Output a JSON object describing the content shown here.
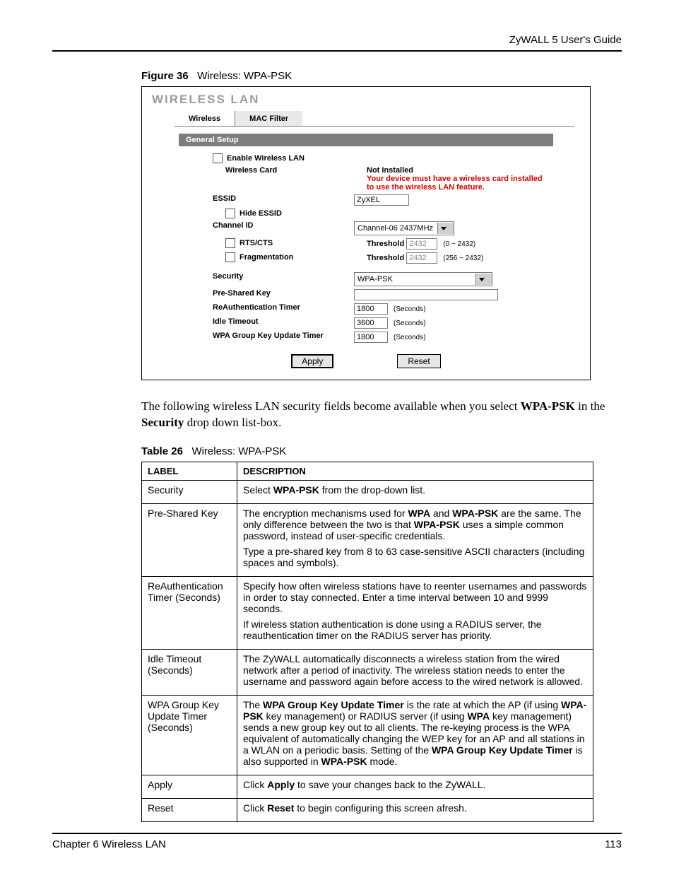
{
  "doc": {
    "running_head": "ZyWALL 5 User's Guide",
    "figure_number": "Figure 36",
    "figure_title": "Wireless: WPA-PSK",
    "table_number": "Table 26",
    "table_title": "Wireless: WPA-PSK",
    "body_para": "The following wireless LAN security fields become available when you select ",
    "body_bold1": "WPA-PSK",
    "body_mid": " in the ",
    "body_bold2": "Security",
    "body_end": " drop down list-box.",
    "footer_left": "Chapter 6 Wireless LAN",
    "footer_right": "113"
  },
  "shot": {
    "title": "WIRELESS LAN",
    "tabs": {
      "wireless": "Wireless",
      "mac": "MAC Filter"
    },
    "section": "General Setup",
    "labels": {
      "enable": "Enable Wireless LAN",
      "card": "Wireless Card",
      "not_installed": "Not Installed",
      "warn": "Your device must have a wireless card installed to use the wireless LAN feature.",
      "essid": "ESSID",
      "hide": "Hide ESSID",
      "channel": "Channel ID",
      "rtscts": "RTS/CTS",
      "frag": "Fragmentation",
      "security": "Security",
      "psk": "Pre-Shared Key",
      "reauth": "ReAuthentication Timer",
      "idle": "Idle Timeout",
      "group": "WPA Group Key Update Timer",
      "threshold": "Threshold",
      "seconds": "(Seconds)",
      "rts_range": "(0 ~ 2432)",
      "frag_range": "(256 ~ 2432)"
    },
    "values": {
      "essid": "ZyXEL",
      "channel": "Channel-06 2437MHz",
      "rts": "2432",
      "frag": "2432",
      "security": "WPA-PSK",
      "psk": "",
      "reauth": "1800",
      "idle": "3600",
      "group": "1800"
    },
    "buttons": {
      "apply": "Apply",
      "reset": "Reset"
    }
  },
  "table": {
    "head_label": "LABEL",
    "head_desc": "DESCRIPTION",
    "rows": [
      {
        "label": "Security",
        "desc": [
          {
            "runs": [
              {
                "t": "Select "
              },
              {
                "b": "WPA-PSK"
              },
              {
                "t": " from the drop-down list."
              }
            ]
          }
        ]
      },
      {
        "label": "Pre-Shared Key",
        "desc": [
          {
            "runs": [
              {
                "t": "The encryption mechanisms used for "
              },
              {
                "b": "WPA"
              },
              {
                "t": " and "
              },
              {
                "b": "WPA-PSK"
              },
              {
                "t": " are the same. The only difference between the two is that "
              },
              {
                "b": "WPA-PSK"
              },
              {
                "t": " uses a simple common password, instead of user-specific credentials."
              }
            ]
          },
          {
            "runs": [
              {
                "t": "Type a pre-shared key from 8 to 63 case-sensitive ASCII characters (including spaces and symbols)."
              }
            ]
          }
        ]
      },
      {
        "label": "ReAuthentication Timer (Seconds)",
        "desc": [
          {
            "runs": [
              {
                "t": "Specify how often wireless stations have to reenter usernames and passwords in order to stay connected. Enter a time interval between 10 and 9999 seconds."
              }
            ]
          },
          {
            "runs": [
              {
                "t": "If wireless station authentication is done using a RADIUS server, the reauthentication timer on the RADIUS server has priority."
              }
            ]
          }
        ]
      },
      {
        "label": "Idle Timeout (Seconds)",
        "desc": [
          {
            "runs": [
              {
                "t": "The ZyWALL automatically disconnects a wireless station from the wired network after a period of inactivity. The wireless station needs to enter the username and password again before access to the wired network is allowed."
              }
            ]
          }
        ]
      },
      {
        "label": "WPA Group Key Update Timer (Seconds)",
        "desc": [
          {
            "runs": [
              {
                "t": "The "
              },
              {
                "b": "WPA Group Key Update Timer"
              },
              {
                "t": " is the rate at which the AP (if using "
              },
              {
                "b": "WPA-PSK"
              },
              {
                "t": " key management) or RADIUS server (if using "
              },
              {
                "b": "WPA"
              },
              {
                "t": " key management) sends a new group key out to all clients. The re-keying process is the WPA equivalent of automatically changing the WEP key for an AP and all stations in a WLAN on a periodic basis. Setting of the "
              },
              {
                "b": "WPA Group Key Update Timer"
              },
              {
                "t": " is also supported in "
              },
              {
                "b": "WPA-PSK"
              },
              {
                "t": " mode."
              }
            ]
          }
        ]
      },
      {
        "label": "Apply",
        "desc": [
          {
            "runs": [
              {
                "t": "Click "
              },
              {
                "b": "Apply"
              },
              {
                "t": " to save your changes back to the ZyWALL."
              }
            ]
          }
        ]
      },
      {
        "label": "Reset",
        "desc": [
          {
            "runs": [
              {
                "t": "Click "
              },
              {
                "b": "Reset"
              },
              {
                "t": " to begin configuring this screen afresh."
              }
            ]
          }
        ]
      }
    ]
  }
}
